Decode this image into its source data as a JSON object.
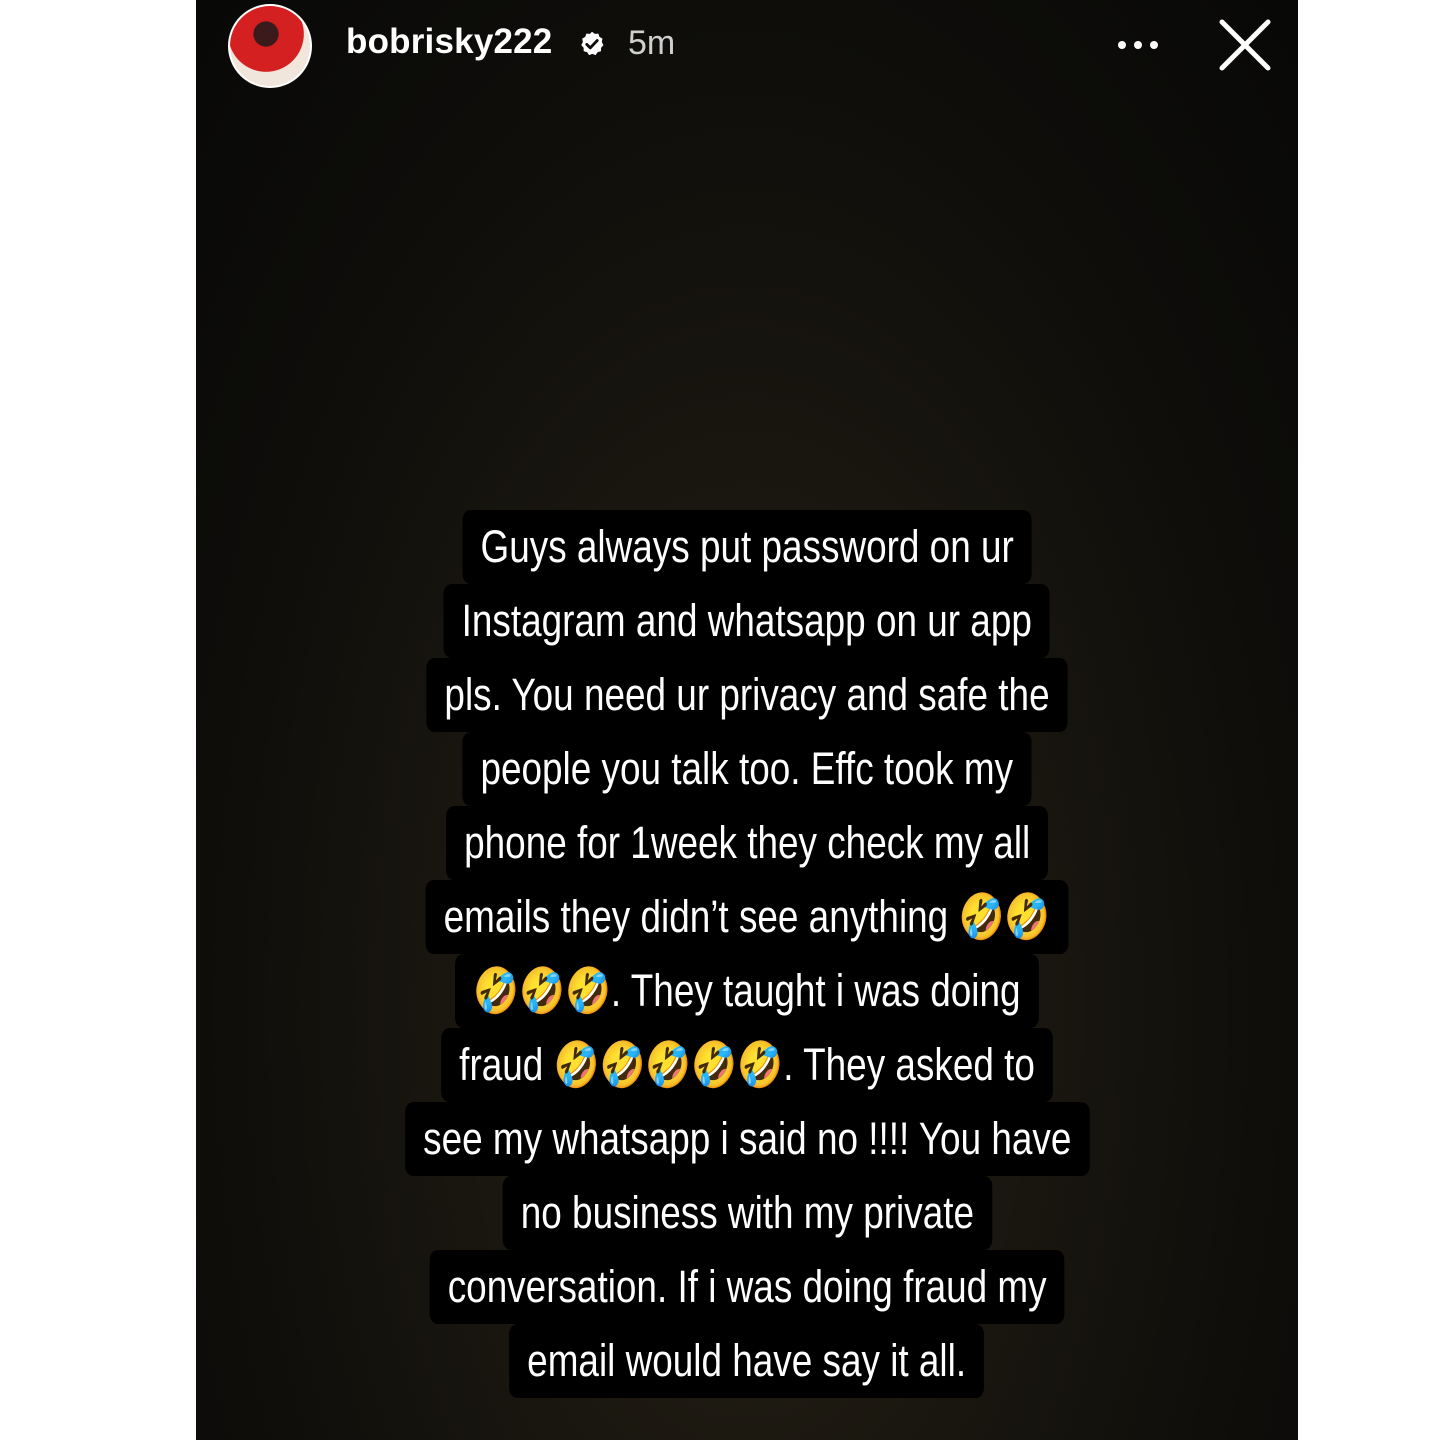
{
  "story": {
    "username": "bobrisky222",
    "timestamp": "5m",
    "verified": true,
    "avatar_icon": "profile-avatar",
    "more_icon": "more-options-icon",
    "close_icon": "close-icon"
  },
  "caption": {
    "lines": [
      "Guys always put password on ur",
      "Instagram and whatsapp on ur app",
      "pls. You need ur privacy and safe the",
      "people you talk too. Effc took my",
      "phone for 1week they check my all",
      "emails they didn’t see anything 🤣🤣",
      "🤣🤣🤣. They taught i was doing",
      "fraud 🤣🤣🤣🤣🤣. They asked to",
      "see my whatsapp i said no !!!! You have",
      "no business with my private",
      "conversation. If i was doing fraud my",
      "email would have say it all."
    ]
  },
  "colors": {
    "background": "#0e0d0a",
    "text": "#ffffff",
    "text_highlight": "#000000",
    "verified_badge": "#ffffff"
  }
}
